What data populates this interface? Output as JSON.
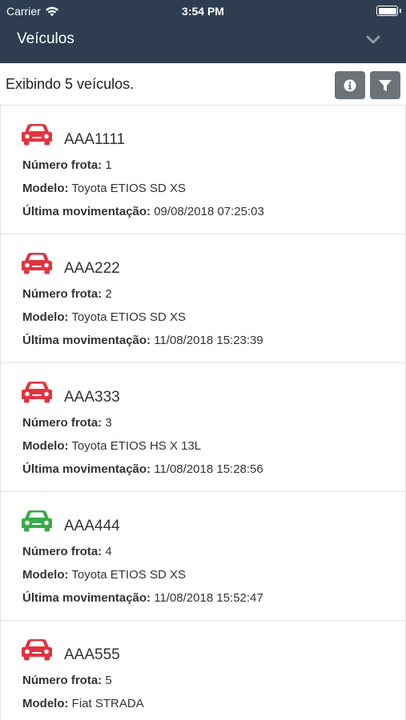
{
  "status_bar": {
    "carrier": "Carrier",
    "time": "3:54 PM"
  },
  "nav": {
    "title": "Veículos",
    "chevron_icon": "chevron-down-icon"
  },
  "subheader": {
    "count_text": "Exibindo 5 veículos.",
    "info_icon": "info-icon",
    "filter_icon": "filter-icon"
  },
  "labels": {
    "fleet": "Número frota:",
    "model": "Modelo:",
    "last_move": "Última movimentação:"
  },
  "colors": {
    "nav_background": "#2e3e50",
    "button_background": "#6b7379",
    "status_red": "#e2343f",
    "status_green": "#3aa94a"
  },
  "vehicles": [
    {
      "plate": "AAA1111",
      "fleet": "1",
      "model": "Toyota ETIOS SD XS",
      "last_move": "09/08/2018 07:25:03",
      "status": "red"
    },
    {
      "plate": "AAA222",
      "fleet": "2",
      "model": "Toyota ETIOS SD XS",
      "last_move": "11/08/2018 15:23:39",
      "status": "red"
    },
    {
      "plate": "AAA333",
      "fleet": "3",
      "model": "Toyota ETIOS HS X 13L",
      "last_move": "11/08/2018 15:28:56",
      "status": "red"
    },
    {
      "plate": "AAA444",
      "fleet": "4",
      "model": "Toyota ETIOS SD XS",
      "last_move": "11/08/2018 15:52:47",
      "status": "green"
    },
    {
      "plate": "AAA555",
      "fleet": "5",
      "model": "Fiat STRADA",
      "status": "red"
    }
  ]
}
